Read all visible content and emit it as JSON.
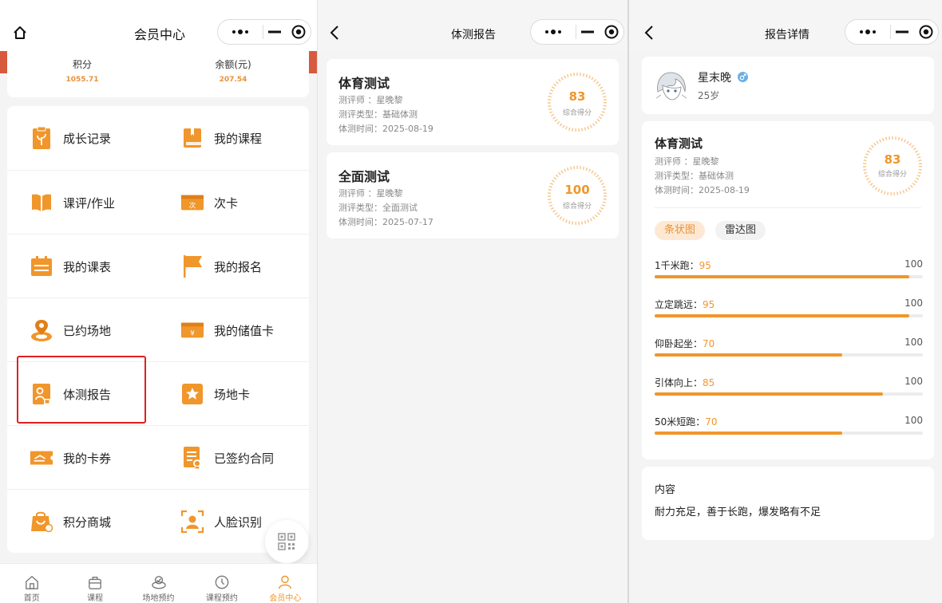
{
  "panel1": {
    "title": "会员中心",
    "stats": [
      {
        "label": "积分",
        "value": "1055.71"
      },
      {
        "label": "余额(元)",
        "value": "207.54"
      }
    ],
    "menu": [
      {
        "label": "成长记录",
        "icon": "growth-record-icon"
      },
      {
        "label": "我的课程",
        "icon": "book-icon"
      },
      {
        "label": "课评/作业",
        "icon": "open-book-icon"
      },
      {
        "label": "次卡",
        "icon": "ticket-icon",
        "badge": "次"
      },
      {
        "label": "我的课表",
        "icon": "schedule-icon"
      },
      {
        "label": "我的报名",
        "icon": "flag-icon"
      },
      {
        "label": "已约场地",
        "icon": "venue-pin-icon"
      },
      {
        "label": "我的储值卡",
        "icon": "wallet-icon",
        "badge": "¥"
      },
      {
        "label": "体测报告",
        "icon": "fitness-report-icon"
      },
      {
        "label": "场地卡",
        "icon": "star-card-icon"
      },
      {
        "label": "我的卡券",
        "icon": "coupon-icon"
      },
      {
        "label": "已签约合同",
        "icon": "contract-icon"
      },
      {
        "label": "积分商城",
        "icon": "shopping-bag-icon"
      },
      {
        "label": "人脸识别",
        "icon": "face-scan-icon"
      }
    ],
    "tabs": [
      {
        "label": "首页",
        "icon": "home-icon"
      },
      {
        "label": "课程",
        "icon": "bag-icon"
      },
      {
        "label": "场地预约",
        "icon": "venue-icon"
      },
      {
        "label": "课程预约",
        "icon": "clock-icon"
      },
      {
        "label": "会员中心",
        "icon": "user-icon"
      }
    ]
  },
  "panel2": {
    "title": "体测报告",
    "reports": [
      {
        "title": "体育测试",
        "assessor": "测评师 ：星晚黎",
        "type": "测评类型：基础体测",
        "date": "体测时间：2025-08-19",
        "score": "83",
        "score_label": "综合得分"
      },
      {
        "title": "全面测试",
        "assessor": "测评师 ：星晚黎",
        "type": "测评类型：全面测试",
        "date": "体测时间：2025-07-17",
        "score": "100",
        "score_label": "综合得分"
      }
    ]
  },
  "panel3": {
    "title": "报告详情",
    "user": {
      "name": "星末晚",
      "age": "25岁"
    },
    "report": {
      "title": "体育测试",
      "assessor": "测评师 ：星晚黎",
      "type": "测评类型：基础体测",
      "date": "体测时间：2025-08-19",
      "score": "83",
      "score_label": "综合得分"
    },
    "chips": [
      "条状图",
      "雷达图"
    ],
    "bars": [
      {
        "name": "1千米跑：",
        "value": 95,
        "value_text": "95",
        "max": "100"
      },
      {
        "name": "立定跳远：",
        "value": 95,
        "value_text": "95",
        "max": "100"
      },
      {
        "name": "仰卧起坐：",
        "value": 70,
        "value_text": "70",
        "max": "100"
      },
      {
        "name": "引体向上：",
        "value": 85,
        "value_text": "85",
        "max": "100"
      },
      {
        "name": "50米短跑：",
        "value": 70,
        "value_text": "70",
        "max": "100"
      }
    ],
    "content_label": "内容",
    "content_text": "耐力充足，善于长跑，爆发略有不足"
  },
  "colors": {
    "accent": "#f0962b",
    "highlight": "#e02020",
    "banner_red": "#d75a3e"
  }
}
